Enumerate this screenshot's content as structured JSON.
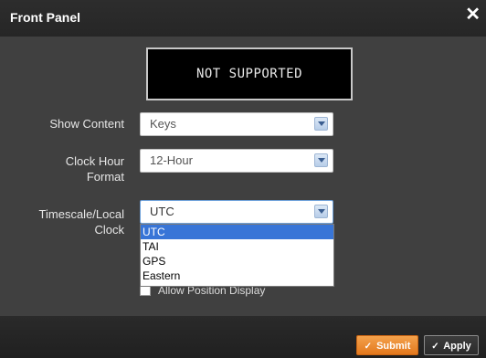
{
  "dialog": {
    "title": "Front Panel",
    "close_glyph": "✕"
  },
  "display": {
    "text": "NOT SUPPORTED"
  },
  "fields": {
    "show_content": {
      "label": "Show Content",
      "value": "Keys"
    },
    "clock_hour_format": {
      "label_line1": "Clock Hour",
      "label_line2": "Format",
      "value": "12-Hour"
    },
    "timescale": {
      "label_line1": "Timescale/Local",
      "label_line2": "Clock",
      "value": "UTC"
    }
  },
  "dropdown": {
    "options": [
      "UTC",
      "TAI",
      "GPS",
      "Eastern"
    ],
    "selected_index": 0
  },
  "obscured_row": {
    "text": "Allow Position Display"
  },
  "footer": {
    "submit_label": "Submit",
    "apply_label": "Apply",
    "check_glyph": "✓"
  },
  "colors": {
    "accent_submit": "#e3781d",
    "selection": "#3875d7",
    "background": "#404040"
  }
}
